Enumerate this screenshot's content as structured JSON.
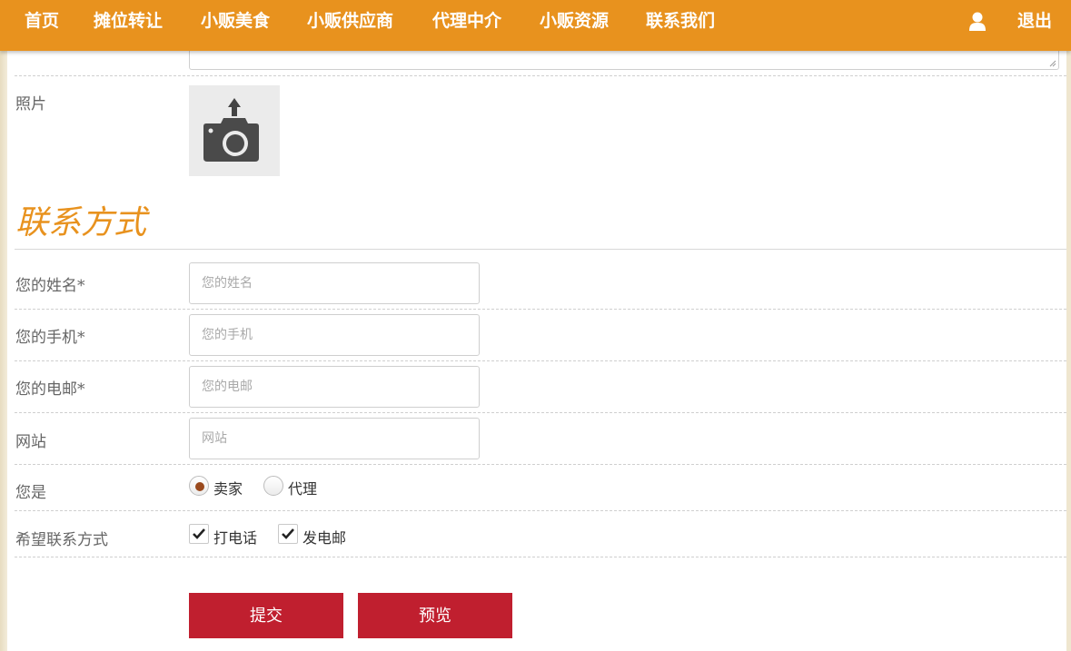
{
  "nav": {
    "items": [
      "首页",
      "摊位转让",
      "小贩美食",
      "小贩供应商",
      "代理中介",
      "小贩资源",
      "联系我们"
    ],
    "logout": "退出"
  },
  "form": {
    "photo_label": "照片",
    "section_title": "联系方式",
    "name": {
      "label": "您的姓名*",
      "placeholder": "您的姓名"
    },
    "phone": {
      "label": "您的手机*",
      "placeholder": "您的手机"
    },
    "email": {
      "label": "您的电邮*",
      "placeholder": "您的电邮"
    },
    "website": {
      "label": "网站",
      "placeholder": "网站"
    },
    "role": {
      "label": "您是",
      "options": [
        {
          "label": "卖家",
          "checked": true
        },
        {
          "label": "代理",
          "checked": false
        }
      ]
    },
    "contact_pref": {
      "label": "希望联系方式",
      "options": [
        {
          "label": "打电话",
          "checked": true
        },
        {
          "label": "发电邮",
          "checked": true
        }
      ]
    },
    "submit_label": "提交",
    "preview_label": "预览"
  },
  "colors": {
    "header": "#e8921e",
    "accent_title": "#e8921e",
    "button": "#c01f2f",
    "radio_dot": "#9a4a1e"
  },
  "icons": {
    "user": "user-icon",
    "camera": "camera-upload-icon",
    "check": "checkmark-icon"
  }
}
